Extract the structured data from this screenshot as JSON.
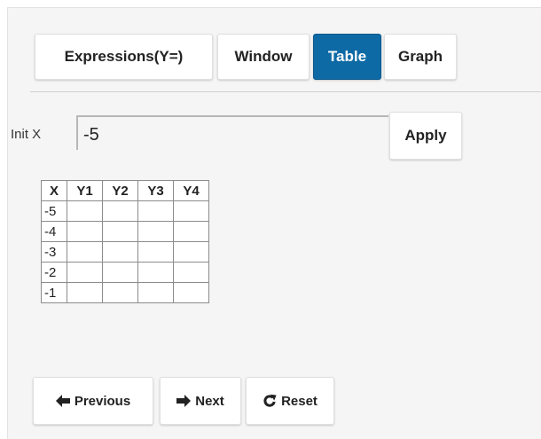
{
  "tabs": [
    {
      "label": "Expressions(Y=)",
      "active": false
    },
    {
      "label": "Window",
      "active": false
    },
    {
      "label": "Table",
      "active": true
    },
    {
      "label": "Graph",
      "active": false
    }
  ],
  "colors": {
    "active_tab": "#0e6aa5",
    "panel_bg": "#f5f5f5"
  },
  "init": {
    "label": "Init X",
    "value": "-5",
    "apply_label": "Apply"
  },
  "table": {
    "columns": [
      "X",
      "Y1",
      "Y2",
      "Y3",
      "Y4"
    ],
    "rows": [
      {
        "x": "-5",
        "y": [
          "",
          "",
          "",
          ""
        ]
      },
      {
        "x": "-4",
        "y": [
          "",
          "",
          "",
          ""
        ]
      },
      {
        "x": "-3",
        "y": [
          "",
          "",
          "",
          ""
        ]
      },
      {
        "x": "-2",
        "y": [
          "",
          "",
          "",
          ""
        ]
      },
      {
        "x": "-1",
        "y": [
          "",
          "",
          "",
          ""
        ]
      }
    ]
  },
  "nav": {
    "previous": {
      "label": "Previous",
      "icon": "arrow-left-icon"
    },
    "next": {
      "label": "Next",
      "icon": "arrow-right-icon"
    },
    "reset": {
      "label": "Reset",
      "icon": "refresh-icon"
    }
  }
}
